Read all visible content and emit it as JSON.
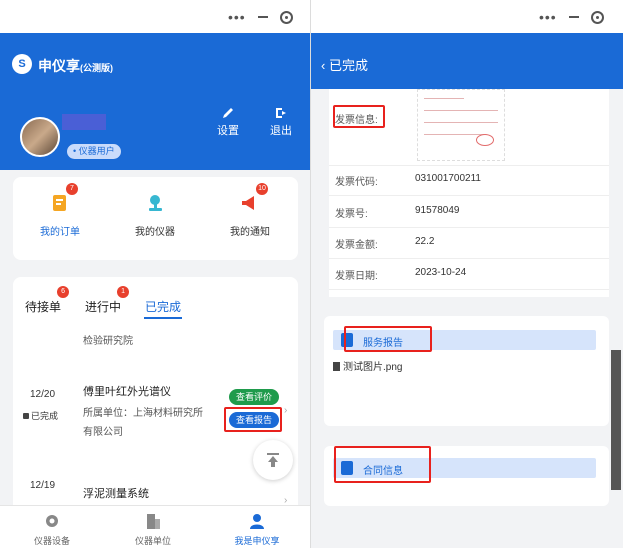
{
  "left": {
    "app_title": "申仪享",
    "app_subtitle": "(公测版)",
    "logo_text": "S",
    "settings_label": "设置",
    "logout_label": "退出",
    "role_badge": "• 仪器用户",
    "menu": [
      {
        "label": "我的订单",
        "badge": "7",
        "icon": "order-icon"
      },
      {
        "label": "我的仪器",
        "badge": "",
        "icon": "microscope-icon"
      },
      {
        "label": "我的通知",
        "badge": "10",
        "icon": "megaphone-icon"
      }
    ],
    "tabs": [
      {
        "label": "待接单",
        "badge": "6"
      },
      {
        "label": "进行中",
        "badge": "1"
      },
      {
        "label": "已完成",
        "badge": ""
      }
    ],
    "list": {
      "partial_text": "检验研究院",
      "item1": {
        "date": "12/20",
        "status": "已完成",
        "title": "傅里叶红外光谱仪",
        "org_line1": "所属单位：上海材料研究所",
        "org_line2": "有限公司",
        "btn_review": "查看评价",
        "btn_report": "查看报告"
      },
      "item2": {
        "date": "12/19",
        "title": "浮泥测量系统"
      }
    },
    "bottom_nav": [
      {
        "label": "仪器设备",
        "icon": "gear-icon"
      },
      {
        "label": "仪器单位",
        "icon": "building-icon"
      },
      {
        "label": "我是申仪享",
        "icon": "user-icon"
      }
    ]
  },
  "right": {
    "header_title": "已完成",
    "back_icon": "chevron-left-icon",
    "invoice_info_label": "发票信息:",
    "fields": [
      {
        "label": "发票代码:",
        "value": "031001700211"
      },
      {
        "label": "发票号:",
        "value": "91578049"
      },
      {
        "label": "发票金额:",
        "value": "22.2"
      },
      {
        "label": "发票日期:",
        "value": "2023-10-24"
      }
    ],
    "service_report_label": "服务报告",
    "file_name": "测试图片.png",
    "contract_info_label": "合同信息"
  },
  "colors": {
    "primary": "#1a6ad6",
    "badge_red": "#e8402d",
    "highlight_red": "#e8211d",
    "green": "#1f9b4c"
  }
}
